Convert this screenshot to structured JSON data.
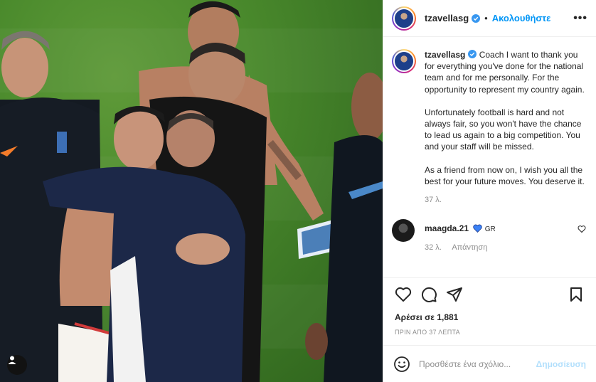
{
  "post": {
    "username": "tzavellasg",
    "follow_label": "Ακολουθήστε",
    "more_label": "•••",
    "caption_paragraphs": [
      "Coach I want to thank you for everything you've done for the national team and for me personally. For the opportunity to represent my country again.",
      "Unfortunately football is hard and not always fair, so you won't have the chance to lead us again to a big competition. You and your staff will be missed.",
      "As a friend from now on, I wish you all the best for your future moves. You deserve it."
    ],
    "caption_age": "37 λ."
  },
  "comments": [
    {
      "username": "maagda.21",
      "text": "GR",
      "age": "32 λ.",
      "reply_label": "Απάντηση"
    }
  ],
  "actions": {
    "likes": "Αρέσει σε 1,881",
    "timestamp": "ΠΡΙΝ ΑΠΟ 37 ΛΕΠΤΑ"
  },
  "composer": {
    "placeholder": "Προσθέστε ένα σχόλιο...",
    "post_label": "Δημοσίευση"
  },
  "icons": [
    "user-tag-icon",
    "verified-icon",
    "more-icon",
    "heart-icon",
    "comment-icon",
    "share-icon",
    "save-icon",
    "emoji-icon",
    "blue-heart-icon"
  ],
  "colors": {
    "accent": "#0095f6",
    "post_disabled": "#b2dffc",
    "verified": "#3897f0"
  }
}
